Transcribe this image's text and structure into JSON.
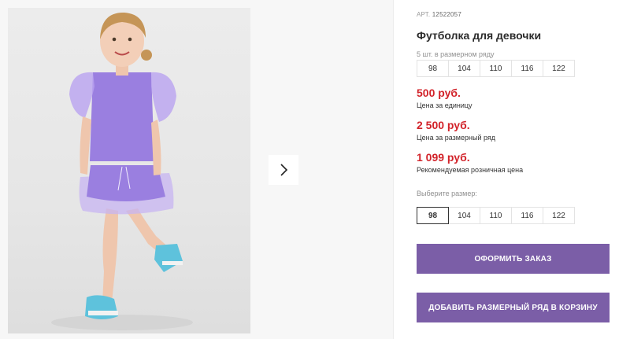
{
  "product": {
    "article_label": "АРТ.",
    "article_number": "12522057",
    "title": "Футболка для девочки",
    "range_note": "5 шт. в размерном ряду"
  },
  "size_table": [
    "98",
    "104",
    "110",
    "116",
    "122"
  ],
  "prices": [
    {
      "amount": "500 руб.",
      "caption": "Цена за единицу"
    },
    {
      "amount": "2 500 руб.",
      "caption": "Цена за размерный ряд"
    },
    {
      "amount": "1 099 руб.",
      "caption": "Рекомендуемая розничная цена"
    }
  ],
  "size_select": {
    "label": "Выберите размер:",
    "options": [
      "98",
      "104",
      "110",
      "116",
      "122"
    ],
    "selected": "98"
  },
  "actions": {
    "order_label": "ОФОРМИТЬ ЗАКАЗ",
    "add_to_cart_label": "ДОБАВИТЬ РАЗМЕРНЫЙ РЯД В КОРЗИНУ"
  },
  "icons": {
    "next": "chevron-right-icon"
  },
  "colors": {
    "price": "#d2232a",
    "button": "#7b5ea7",
    "garment": "#9a7fe0"
  }
}
